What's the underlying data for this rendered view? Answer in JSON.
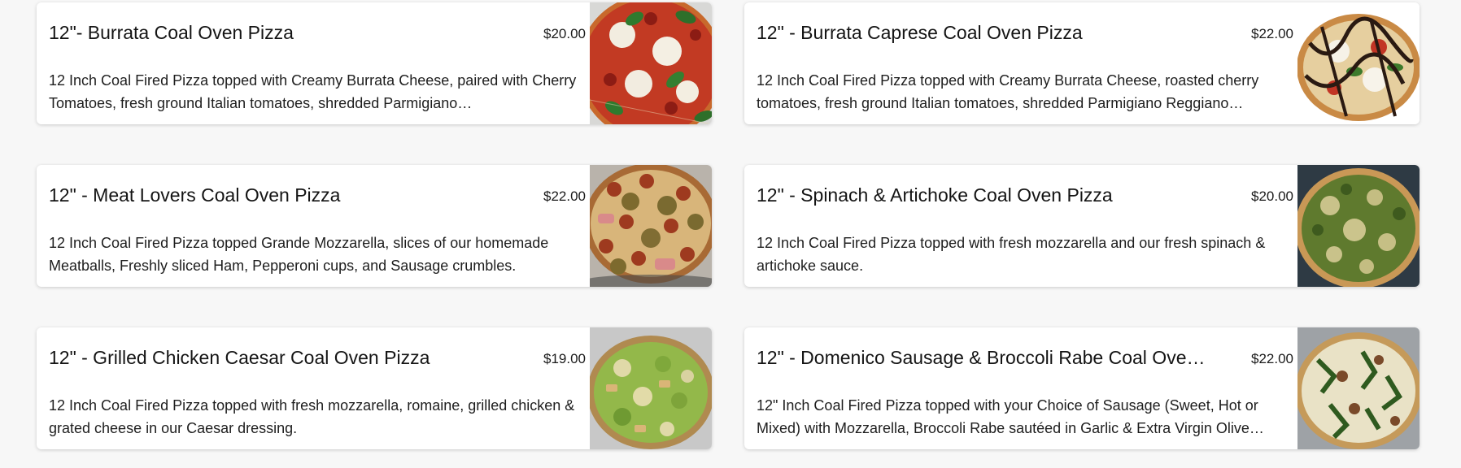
{
  "menu": {
    "items": [
      {
        "title": "12\"- Burrata Coal Oven Pizza",
        "price": "$20.00",
        "description": "12 Inch Coal Fired Pizza topped with Creamy Burrata Cheese, paired with Cherry Tomatoes, fresh ground Italian tomatoes, shredded Parmigiano…",
        "photo_icon": "burrata-pizza-photo"
      },
      {
        "title": "12\" - Burrata Caprese Coal Oven Pizza",
        "price": "$22.00",
        "description": "12 Inch Coal Fired Pizza topped with Creamy Burrata Cheese, roasted cherry tomatoes, fresh ground Italian tomatoes, shredded Parmigiano Reggiano…",
        "photo_icon": "caprese-pizza-photo"
      },
      {
        "title": "12\" - Meat Lovers Coal Oven Pizza",
        "price": "$22.00",
        "description": "12 Inch Coal Fired Pizza topped Grande Mozzarella, slices of our homemade Meatballs, Freshly sliced Ham, Pepperoni cups, and Sausage crumbles.",
        "photo_icon": "meat-lovers-pizza-photo"
      },
      {
        "title": "12\" - Spinach & Artichoke Coal Oven Pizza",
        "price": "$20.00",
        "description": "12 Inch Coal Fired Pizza topped with fresh mozzarella and our fresh spinach & artichoke sauce.",
        "photo_icon": "spinach-artichoke-pizza-photo"
      },
      {
        "title": "12\" - Grilled Chicken Caesar Coal Oven Pizza",
        "price": "$19.00",
        "description": "12 Inch Coal Fired Pizza topped with fresh mozzarella, romaine, grilled chicken & grated cheese in our Caesar dressing.",
        "photo_icon": "chicken-caesar-pizza-photo"
      },
      {
        "title": "12\" - Domenico Sausage & Broccoli Rabe Coal Oven…",
        "price": "$22.00",
        "description": "12\" Inch Coal Fired Pizza topped with your Choice of Sausage (Sweet, Hot or Mixed) with Mozzarella, Broccoli Rabe sautéed in Garlic & Extra Virgin Olive…",
        "photo_icon": "sausage-broccoli-rabe-pizza-photo"
      }
    ]
  },
  "colors": {
    "background": "#f7f7f7",
    "card": "#ffffff",
    "text": "#141414"
  }
}
